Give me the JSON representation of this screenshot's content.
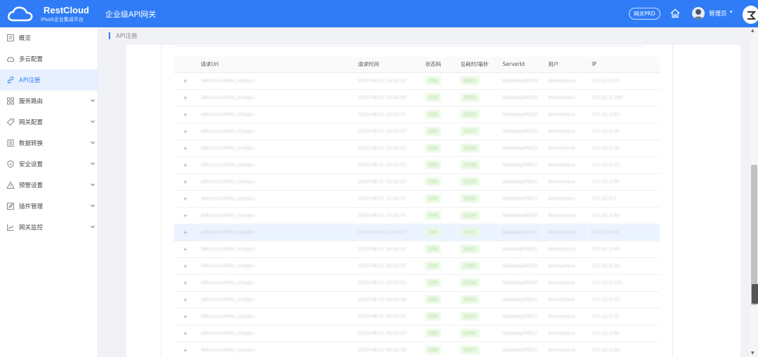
{
  "header": {
    "brand": "RestCloud",
    "brand_sub": "iPaaS企业集成平台",
    "title": "企业级API网关",
    "env_label": "网关PRD",
    "user_name": "管理员",
    "user_caret": "▾",
    "accent_color": "#2f7cf6"
  },
  "sidebar": {
    "items": [
      {
        "label": "概览",
        "icon": "overview-icon",
        "has_children": false,
        "active": false
      },
      {
        "label": "多云配置",
        "icon": "cloud-icon",
        "has_children": false,
        "active": false
      },
      {
        "label": "API注册",
        "icon": "link-icon",
        "has_children": false,
        "active": true
      },
      {
        "label": "服务路由",
        "icon": "grid-icon",
        "has_children": true,
        "active": false
      },
      {
        "label": "网关配置",
        "icon": "tag-icon",
        "has_children": true,
        "active": false
      },
      {
        "label": "数据转换",
        "icon": "document-icon",
        "has_children": true,
        "active": false
      },
      {
        "label": "安全设置",
        "icon": "shield-icon",
        "has_children": true,
        "active": false
      },
      {
        "label": "预警设置",
        "icon": "warning-icon",
        "has_children": true,
        "active": false
      },
      {
        "label": "插件管理",
        "icon": "edit-icon",
        "has_children": true,
        "active": false
      },
      {
        "label": "网关监控",
        "icon": "chart-icon",
        "has_children": true,
        "active": false
      }
    ]
  },
  "breadcrumb": {
    "current": "API注册"
  },
  "table": {
    "columns": [
      "",
      "请求Url",
      "请求时间",
      "状态码",
      "总耗时/毫秒",
      "ServerId",
      "用户",
      "IP"
    ],
    "expand_symbol": "+",
    "highlight_row_index": 9,
    "rows": [
      {
        "url": "/leftc/v1/vmfhn_crrpqru",
        "time": "2023-08-31 14:02:57",
        "status": "200",
        "duration": "2815",
        "server": "GatewayA0023",
        "user": "Anonymous",
        "ip": "172.22.2.93"
      },
      {
        "url": "/leftc/v1/vmfhn_crrpqru",
        "time": "2023-08-31 13:40:58",
        "status": "200",
        "duration": "2975",
        "server": "GatewayA0023",
        "user": "Anonymous",
        "ip": "172.22.2.199"
      },
      {
        "url": "/leftc/v1/vmfhn_crrpqru",
        "time": "2023-08-31 13:22:57",
        "status": "200",
        "duration": "2153",
        "server": "GatewayA0023",
        "user": "Anonymous",
        "ip": "172.22.2.93"
      },
      {
        "url": "/leftc/v1/vmfhn_crrpqru",
        "time": "2023-08-31 13:02:57",
        "status": "200",
        "duration": "2371",
        "server": "GatewayA0023",
        "user": "Anonymous",
        "ip": "172.22.2.39"
      },
      {
        "url": "/leftc/v1/vmfhn_crrpqru",
        "time": "2023-08-31 12:42:57",
        "status": "200",
        "duration": "2129",
        "server": "GatewayA0023",
        "user": "Anonymous",
        "ip": "172.22.2.39"
      },
      {
        "url": "/leftc/v1/vmfhn_crrpqru",
        "time": "2023-08-31 12:22:57",
        "status": "200",
        "duration": "2136",
        "server": "GatewayF0913",
        "user": "Anonymous",
        "ip": "172.22.2.15"
      },
      {
        "url": "/leftc/v1/vmfhn_crrpqru",
        "time": "2023-08-31 12:02:57",
        "status": "200",
        "duration": "2122",
        "server": "GatewayF0913",
        "user": "Anonymous",
        "ip": "172.22.2.59"
      },
      {
        "url": "/leftc/v1/vmfhn_crrpqru",
        "time": "2023-08-31 11:42:57",
        "status": "200",
        "duration": "2245",
        "server": "GatewayF0913",
        "user": "Anonymous",
        "ip": "172.22.0.2"
      },
      {
        "url": "/leftc/v1/vmfhn_crrpqru",
        "time": "2023-08-31 11:22:57",
        "status": "200",
        "duration": "2124",
        "server": "GatewayA0023",
        "user": "Anonymous",
        "ip": "172.22.2.93"
      },
      {
        "url": "/leftc/v1/vmfhn_crrpqru",
        "time": "2023-08-31 11:02:57",
        "status": "200",
        "duration": "2273",
        "server": "GatewayF0913",
        "user": "Anonymous",
        "ip": "172.22.2.93"
      },
      {
        "url": "/leftc/v1/vmfhn_crrpqru",
        "time": "2023-08-31 10:42:57",
        "status": "200",
        "duration": "2467",
        "server": "GatewayF0913",
        "user": "Anonymous",
        "ip": "172.22.2.93"
      },
      {
        "url": "/leftc/v1/vmfhn_crrpqru",
        "time": "2023-08-31 10:22:57",
        "status": "200",
        "duration": "2362",
        "server": "GatewayA0023",
        "user": "Anonymous",
        "ip": "172.22.0.34"
      },
      {
        "url": "/leftc/v1/vmfhn_crrpqru",
        "time": "2023-08-31 10:02:57",
        "status": "200",
        "duration": "2226",
        "server": "GatewayA0023",
        "user": "Anonymous",
        "ip": "172.22.2.103"
      },
      {
        "url": "/leftc/v1/vmfhn_crrpqru",
        "time": "2023-08-31 09:42:58",
        "status": "200",
        "duration": "3002",
        "server": "GatewayF0913",
        "user": "Anonymous",
        "ip": "172.22.0.15"
      },
      {
        "url": "/leftc/v1/vmfhn_crrpqru",
        "time": "2023-08-31 09:22:57",
        "status": "200",
        "duration": "2215",
        "server": "GatewayF0913",
        "user": "Anonymous",
        "ip": "172.22.0.15"
      },
      {
        "url": "/leftc/v1/vmfhn_crrpqru",
        "time": "2023-08-31 09:02:57",
        "status": "200",
        "duration": "2290",
        "server": "GatewayF0913",
        "user": "Anonymous",
        "ip": "172.22.2.92"
      },
      {
        "url": "/leftc/v1/vmfhn_crrpqru",
        "time": "2023-08-31 08:42:58",
        "status": "200",
        "duration": "2937",
        "server": "GatewayF0913",
        "user": "Anonymous",
        "ip": "172.22.2.59"
      }
    ]
  }
}
